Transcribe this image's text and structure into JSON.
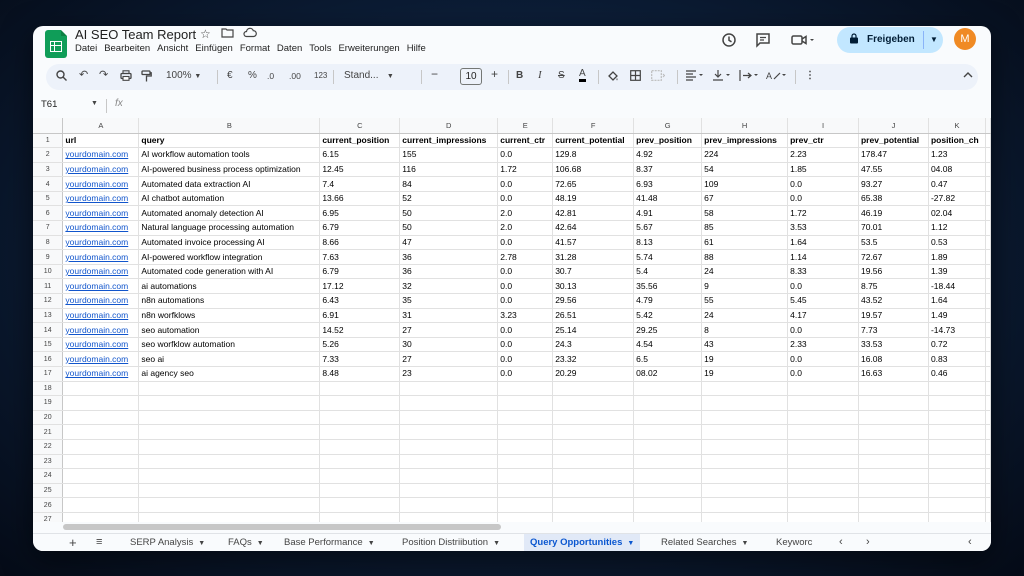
{
  "app": {
    "title": "AI SEO Team Report",
    "menu": [
      "Datei",
      "Bearbeiten",
      "Ansicht",
      "Einfügen",
      "Format",
      "Daten",
      "Tools",
      "Erweiterungen",
      "Hilfe"
    ],
    "share_label": "Freigeben",
    "avatar_letter": "M",
    "accent_color": "#0f9d58",
    "share_color": "#c2e7ff"
  },
  "toolbar": {
    "zoom": "100%",
    "currency": "€",
    "percent": "%",
    "dec_decrease": ".0",
    "dec_increase": ".00",
    "number_format": "123",
    "font": "Stand...",
    "font_size": "10"
  },
  "formula_bar": {
    "cell_ref": "T61",
    "fx": "fx"
  },
  "columns": [
    "A",
    "B",
    "C",
    "D",
    "E",
    "F",
    "G",
    "H",
    "I",
    "J",
    "K"
  ],
  "row_count": 27,
  "rows": [
    [
      "url",
      "query",
      "current_position",
      "current_impressions",
      "current_ctr",
      "current_potential",
      "prev_position",
      "prev_impressions",
      "prev_ctr",
      "prev_potential",
      "position_ch"
    ],
    [
      "yourdomain.com",
      "AI workflow automation tools",
      "6.15",
      "155",
      "0.0",
      "129.8",
      "4.92",
      "224",
      "2.23",
      "178.47",
      "1.23"
    ],
    [
      "yourdomain.com",
      "AI-powered business process optimization",
      "12.45",
      "116",
      "1.72",
      "106.68",
      "8.37",
      "54",
      "1.85",
      "47.55",
      "04.08"
    ],
    [
      "yourdomain.com",
      "Automated data extraction AI",
      "7.4",
      "84",
      "0.0",
      "72.65",
      "6.93",
      "109",
      "0.0",
      "93.27",
      "0.47"
    ],
    [
      "yourdomain.com",
      "AI chatbot automation",
      "13.66",
      "52",
      "0.0",
      "48.19",
      "41.48",
      "67",
      "0.0",
      "65.38",
      "-27.82"
    ],
    [
      "yourdomain.com",
      "Automated anomaly detection AI",
      "6.95",
      "50",
      "2.0",
      "42.81",
      "4.91",
      "58",
      "1.72",
      "46.19",
      "02.04"
    ],
    [
      "yourdomain.com",
      "Natural language processing automation",
      "6.79",
      "50",
      "2.0",
      "42.64",
      "5.67",
      "85",
      "3.53",
      "70.01",
      "1.12"
    ],
    [
      "yourdomain.com",
      "Automated invoice processing AI",
      "8.66",
      "47",
      "0.0",
      "41.57",
      "8.13",
      "61",
      "1.64",
      "53.5",
      "0.53"
    ],
    [
      "yourdomain.com",
      "AI-powered workflow integration",
      "7.63",
      "36",
      "2.78",
      "31.28",
      "5.74",
      "88",
      "1.14",
      "72.67",
      "1.89"
    ],
    [
      "yourdomain.com",
      "Automated code generation with AI",
      "6.79",
      "36",
      "0.0",
      "30.7",
      "5.4",
      "24",
      "8.33",
      "19.56",
      "1.39"
    ],
    [
      "yourdomain.com",
      "ai automations",
      "17.12",
      "32",
      "0.0",
      "30.13",
      "35.56",
      "9",
      "0.0",
      "8.75",
      "-18.44"
    ],
    [
      "yourdomain.com",
      "n8n automations",
      "6.43",
      "35",
      "0.0",
      "29.56",
      "4.79",
      "55",
      "5.45",
      "43.52",
      "1.64"
    ],
    [
      "yourdomain.com",
      "n8n worfklows",
      "6.91",
      "31",
      "3.23",
      "26.51",
      "5.42",
      "24",
      "4.17",
      "19.57",
      "1.49"
    ],
    [
      "yourdomain.com",
      "seo automation",
      "14.52",
      "27",
      "0.0",
      "25.14",
      "29.25",
      "8",
      "0.0",
      "7.73",
      "-14.73"
    ],
    [
      "yourdomain.com",
      "seo worfklow automation",
      "5.26",
      "30",
      "0.0",
      "24.3",
      "4.54",
      "43",
      "2.33",
      "33.53",
      "0.72"
    ],
    [
      "yourdomain.com",
      "seo ai",
      "7.33",
      "27",
      "0.0",
      "23.32",
      "6.5",
      "19",
      "0.0",
      "16.08",
      "0.83"
    ],
    [
      "yourdomain.com",
      "ai agency seo",
      "8.48",
      "23",
      "0.0",
      "20.29",
      "08.02",
      "19",
      "0.0",
      "16.63",
      "0.46"
    ]
  ],
  "sheets": [
    {
      "label": "SERP Analysis",
      "active": false
    },
    {
      "label": "FAQs",
      "active": false
    },
    {
      "label": "Base Performance",
      "active": false
    },
    {
      "label": "Position Distriibution",
      "active": false
    },
    {
      "label": "Query Opportunities",
      "active": true
    },
    {
      "label": "Related Searches",
      "active": false
    },
    {
      "label": "Keyworc",
      "active": false
    }
  ],
  "icons": {
    "star": "star-icon",
    "folder": "move-folder-icon",
    "cloud": "cloud-saved-icon",
    "history": "history-icon",
    "comment": "comment-icon",
    "meet": "video-call-icon"
  }
}
